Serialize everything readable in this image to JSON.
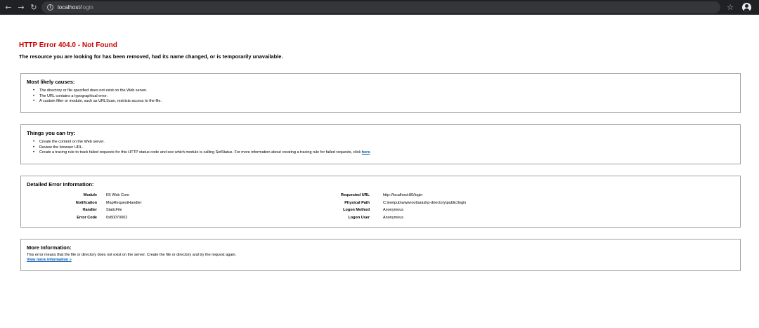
{
  "browser": {
    "back_icon": "arrow-left-icon",
    "forward_icon": "arrow-right-icon",
    "reload_icon": "reload-icon",
    "url_host": "localhost",
    "url_path": "/login",
    "star_icon": "star-icon",
    "profile_icon": "avatar-icon"
  },
  "error": {
    "title": "HTTP Error 404.0 - Not Found",
    "subtitle": "The resource you are looking for has been removed, had its name changed, or is temporarily unavailable."
  },
  "causes": {
    "heading": "Most likely causes:",
    "items": [
      "The directory or file specified does not exist on the Web server.",
      "The URL contains a typographical error.",
      "A custom filter or module, such as URLScan, restricts access to the file."
    ]
  },
  "try": {
    "heading": "Things you can try:",
    "items": [
      "Create the content on the Web server.",
      "Review the browser URL."
    ],
    "tracing_text": "Create a tracing rule to track failed requests for this HTTP status code and see which module is calling SetStatus. For more information about creating a tracing rule for failed requests, click ",
    "tracing_link": "here",
    "tracing_end": "."
  },
  "details": {
    "heading": "Detailed Error Information:",
    "left": [
      {
        "label": "Module",
        "value": "IIS Web Core"
      },
      {
        "label": "Notification",
        "value": "MapRequestHandler"
      },
      {
        "label": "Handler",
        "value": "StaticFile"
      },
      {
        "label": "Error Code",
        "value": "0x80070002"
      }
    ],
    "right": [
      {
        "label": "Requested URL",
        "value": "http://localhost:80/login"
      },
      {
        "label": "Physical Path",
        "value": "C:\\inetpub\\wwwroot\\arashp-directory\\public\\login"
      },
      {
        "label": "Logon Method",
        "value": "Anonymous"
      },
      {
        "label": "Logon User",
        "value": "Anonymous"
      }
    ]
  },
  "more": {
    "heading": "More Information:",
    "text": "This error means that the file or directory does not exist on the server. Create the file or directory and try the request again.",
    "link": "View more information »"
  }
}
